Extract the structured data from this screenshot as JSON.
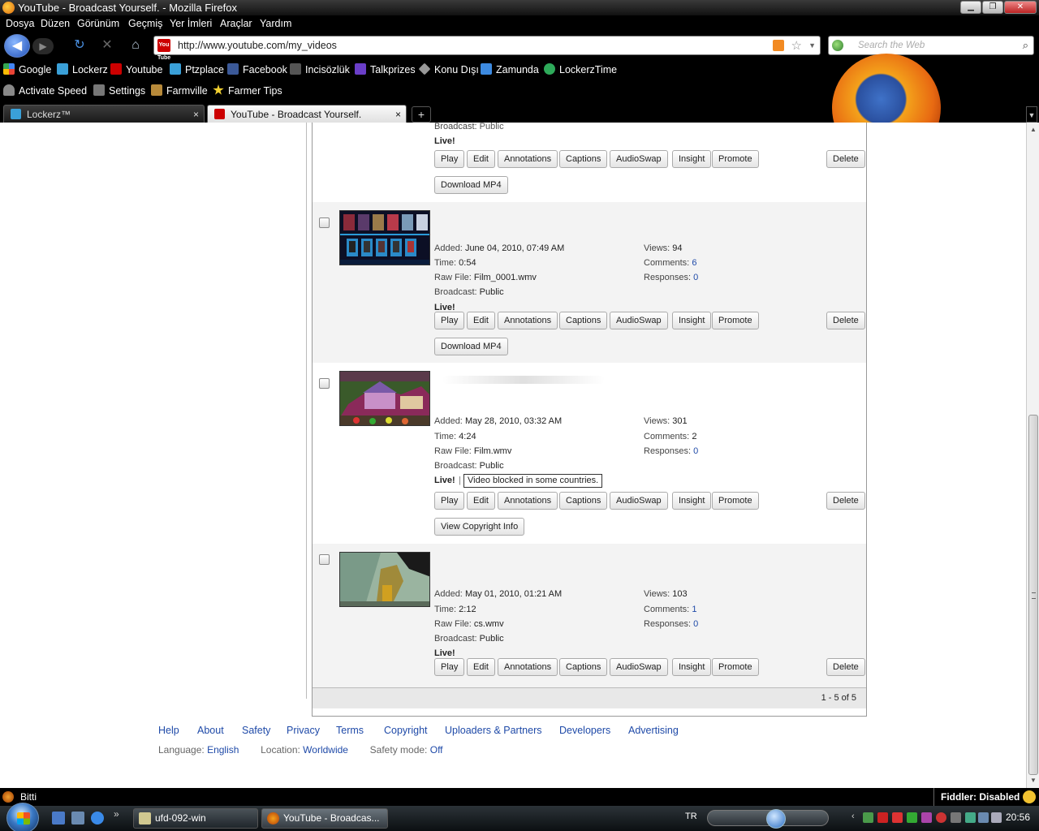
{
  "window": {
    "title": "YouTube - Broadcast Yourself. - Mozilla Firefox"
  },
  "menu": [
    "Dosya",
    "Düzen",
    "Görünüm",
    "Geçmiş",
    "Yer İmleri",
    "Araçlar",
    "Yardım"
  ],
  "nav": {
    "url": "http://www.youtube.com/my_videos",
    "favicon_text": "You Tube",
    "search_placeholder": "Search the Web"
  },
  "bookmarks_row1": [
    "Google",
    "Lockerz",
    "Youtube",
    "Ptzplace",
    "Facebook",
    "Incisözlük",
    "Talkprizes",
    "Konu Dışı",
    "Zamunda",
    "LockerzTime"
  ],
  "bookmarks_row2": [
    "Activate Speed",
    "Settings",
    "Farmville",
    "Farmer Tips"
  ],
  "tabs": [
    {
      "label": "Lockerz™",
      "close": "×"
    },
    {
      "label": "YouTube - Broadcast Yourself.",
      "close": "×"
    }
  ],
  "newtab": "+",
  "labels": {
    "added": "Added:",
    "time": "Time:",
    "raw": "Raw File:",
    "broadcast": "Broadcast:",
    "views": "Views:",
    "comments": "Comments:",
    "responses": "Responses:",
    "live": "Live!"
  },
  "buttons": {
    "play": "Play",
    "edit": "Edit",
    "annotations": "Annotations",
    "captions": "Captions",
    "audioswap": "AudioSwap",
    "insight": "Insight",
    "promote": "Promote",
    "delete": "Delete",
    "download": "Download MP4",
    "copyright": "View Copyright Info"
  },
  "videos": [
    {
      "broadcast": "Public",
      "partial": true
    },
    {
      "added": "June 04, 2010, 07:49 AM",
      "time": "0:54",
      "raw": "Film_0001.wmv",
      "broadcast": "Public",
      "views": "94",
      "comments": "6",
      "responses": "0"
    },
    {
      "added": "May 28, 2010, 03:32 AM",
      "time": "4:24",
      "raw": "Film.wmv",
      "broadcast": "Public",
      "views": "301",
      "comments": "2",
      "responses": "0",
      "notice": "Video blocked in some countries."
    },
    {
      "added": "May 01, 2010, 01:21 AM",
      "time": "2:12",
      "raw": "cs.wmv",
      "broadcast": "Public",
      "views": "103",
      "comments": "1",
      "responses": "0"
    }
  ],
  "pager": "1 - 5 of 5",
  "footer": {
    "links": [
      "Help",
      "About",
      "Safety",
      "Privacy",
      "Terms",
      "Copyright",
      "Uploaders & Partners",
      "Developers",
      "Advertising"
    ],
    "language_label": "Language:",
    "language": "English",
    "location_label": "Location:",
    "location": "Worldwide",
    "safety_label": "Safety mode:",
    "safety": "Off"
  },
  "status": {
    "text": "Bitti",
    "fiddler": "Fiddler: Disabled"
  },
  "taskbar": {
    "items": [
      "ufd-092-win",
      "YouTube - Broadcas..."
    ],
    "lang": "TR",
    "clock": "20:56"
  },
  "colors": {
    "link": "#1f4aa8",
    "chrome": "#000000",
    "row_alt": "#f3f3f3"
  }
}
